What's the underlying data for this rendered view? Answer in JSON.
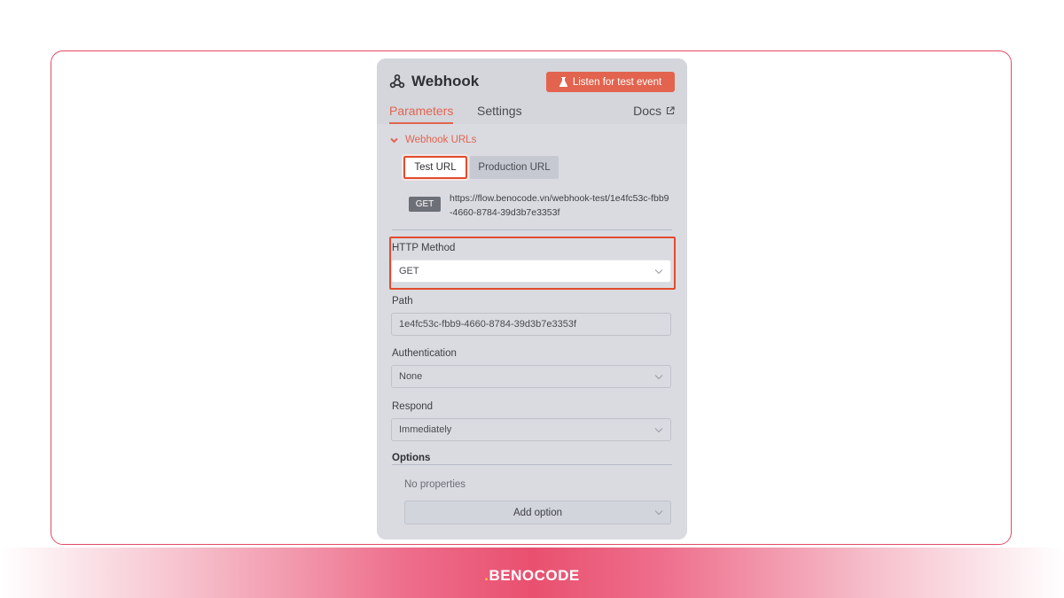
{
  "panel": {
    "title": "Webhook",
    "listen_button": "Listen for test event",
    "tabs": {
      "parameters": "Parameters",
      "settings": "Settings",
      "docs": "Docs"
    }
  },
  "webhook_urls": {
    "section_title": "Webhook URLs",
    "test_tab": "Test URL",
    "production_tab": "Production URL",
    "method_chip": "GET",
    "url": "https://flow.benocode.vn/webhook-test/1e4fc53c-fbb9-4660-8784-39d3b7e3353f"
  },
  "fields": {
    "http_method": {
      "label": "HTTP Method",
      "value": "GET"
    },
    "path": {
      "label": "Path",
      "value": "1e4fc53c-fbb9-4660-8784-39d3b7e3353f"
    },
    "authentication": {
      "label": "Authentication",
      "value": "None"
    },
    "respond": {
      "label": "Respond",
      "value": "Immediately"
    }
  },
  "options": {
    "label": "Options",
    "empty_text": "No properties",
    "add_button": "Add option"
  },
  "footer": {
    "brand": "BENOCODE"
  },
  "colors": {
    "accent": "#e2644e",
    "highlight": "#e34b2d",
    "frame": "#e24a67"
  }
}
